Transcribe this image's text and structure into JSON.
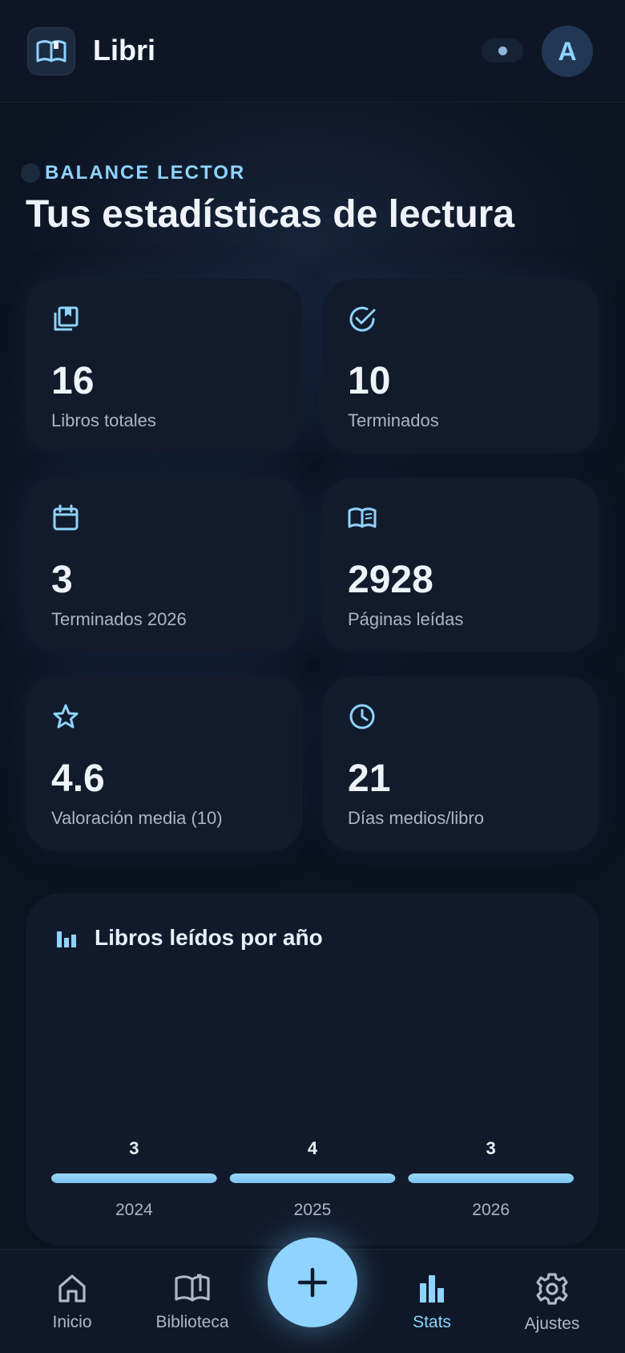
{
  "app": {
    "title": "Libri",
    "avatar_initial": "A"
  },
  "section": {
    "eyebrow": "BALANCE LECTOR",
    "title": "Tus estadísticas de lectura"
  },
  "stats": [
    {
      "icon": "books-icon",
      "value": "16",
      "label": "Libros totales"
    },
    {
      "icon": "check-circle-icon",
      "value": "10",
      "label": "Terminados"
    },
    {
      "icon": "calendar-icon",
      "value": "3",
      "label": "Terminados 2026"
    },
    {
      "icon": "open-book-icon",
      "value": "2928",
      "label": "Páginas leídas"
    },
    {
      "icon": "star-icon",
      "value": "4.6",
      "label": "Valoración media (10)"
    },
    {
      "icon": "clock-icon",
      "value": "21",
      "label": "Días medios/libro"
    }
  ],
  "chart_data": {
    "type": "bar",
    "title": "Libros leídos por año",
    "categories": [
      "2024",
      "2025",
      "2026"
    ],
    "values": [
      3,
      4,
      3
    ],
    "data_labels": [
      "3",
      "4",
      "3"
    ],
    "xlabel": "",
    "ylabel": "",
    "grid": false,
    "legend": "none",
    "bar_color": "#7cc4f0"
  },
  "nav": {
    "items": [
      {
        "icon": "home-icon",
        "label": "Inicio",
        "active": false
      },
      {
        "icon": "library-icon",
        "label": "Biblioteca",
        "active": false
      },
      {
        "icon": "bar-chart-icon",
        "label": "Stats",
        "active": true
      },
      {
        "icon": "gear-icon",
        "label": "Ajustes",
        "active": false
      }
    ],
    "fab_icon": "plus-icon"
  },
  "colors": {
    "background": "#0b1220",
    "card": "#111b2b",
    "accent": "#8fd3ff",
    "text_primary": "#eef3f9",
    "text_secondary": "#a9b6c7"
  }
}
